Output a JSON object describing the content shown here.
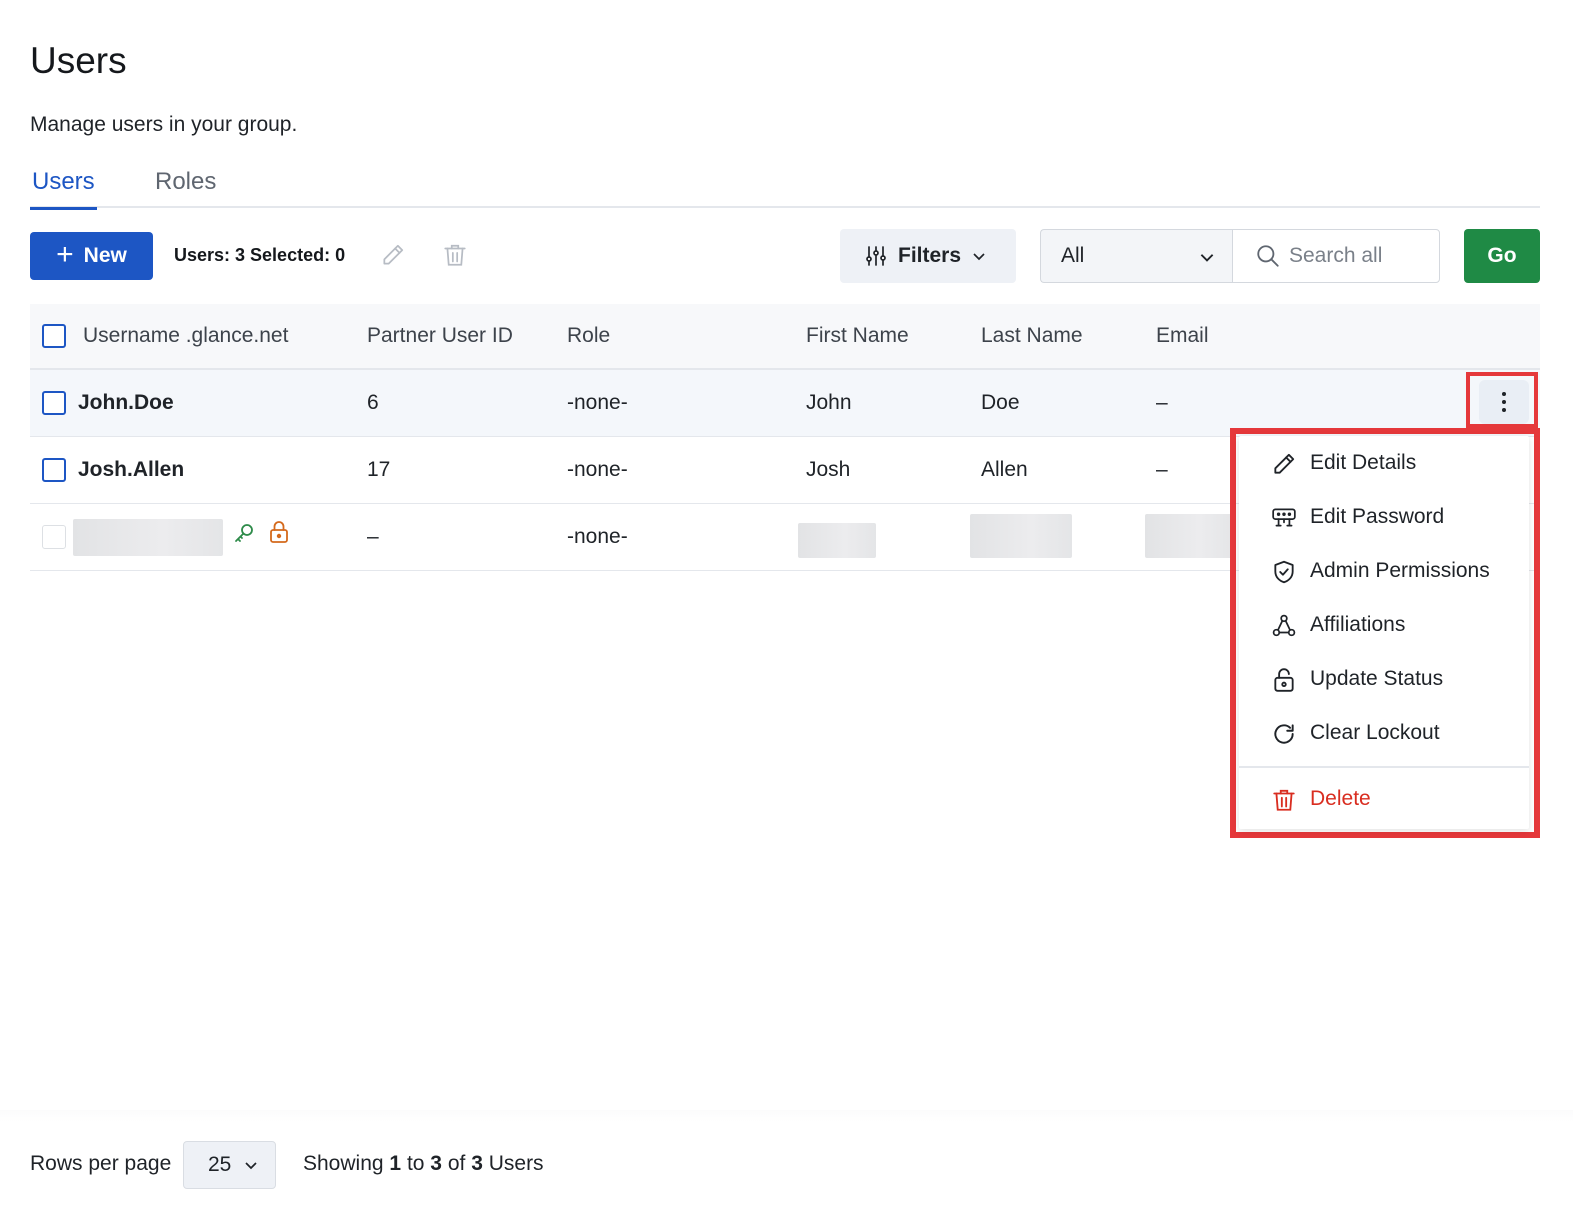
{
  "page": {
    "title": "Users",
    "subtitle": "Manage users in your group."
  },
  "tabs": [
    {
      "label": "Users",
      "active": true
    },
    {
      "label": "Roles",
      "active": false
    }
  ],
  "toolbar": {
    "new_label": "New",
    "users_count_label": "Users: 3 Selected: 0",
    "filters_label": "Filters",
    "scope_value": "All",
    "search_placeholder": "Search all",
    "go_label": "Go"
  },
  "table": {
    "headers": {
      "username": "Username .glance.net",
      "partner_id": "Partner User ID",
      "role": "Role",
      "first_name": "First Name",
      "last_name": "Last Name",
      "email": "Email"
    },
    "rows": [
      {
        "username": "John.Doe",
        "partner_id": "6",
        "role": "-none-",
        "first_name": "John",
        "last_name": "Doe",
        "email": "–"
      },
      {
        "username": "Josh.Allen",
        "partner_id": "17",
        "role": "-none-",
        "first_name": "Josh",
        "last_name": "Allen",
        "email": "–"
      },
      {
        "username": "",
        "partner_id": "–",
        "role": "-none-",
        "first_name": "",
        "last_name": "",
        "email": "",
        "icons": [
          "key-icon",
          "lock-icon"
        ]
      }
    ]
  },
  "row_menu": {
    "items": [
      {
        "label": "Edit Details",
        "icon": "pencil-icon"
      },
      {
        "label": "Edit Password",
        "icon": "password-icon"
      },
      {
        "label": "Admin Permissions",
        "icon": "shield-icon"
      },
      {
        "label": "Affiliations",
        "icon": "affiliations-icon"
      },
      {
        "label": "Update Status",
        "icon": "lock-icon"
      },
      {
        "label": "Clear Lockout",
        "icon": "refresh-icon"
      },
      {
        "label": "Delete",
        "icon": "trash-icon"
      }
    ]
  },
  "pagination": {
    "rows_per_page_label": "Rows per page",
    "rows_per_page_value": "25",
    "showing_prefix": "Showing",
    "from": "1",
    "to_word": "to",
    "to": "3",
    "of_word": "of",
    "total": "3",
    "suffix": "Users"
  },
  "colors": {
    "primary": "#1d56c4",
    "go": "#1f8a45",
    "danger": "#d92d20",
    "highlight_box": "#e5383b",
    "key_icon": "#2e8b4a",
    "lock_icon": "#d4691c"
  }
}
